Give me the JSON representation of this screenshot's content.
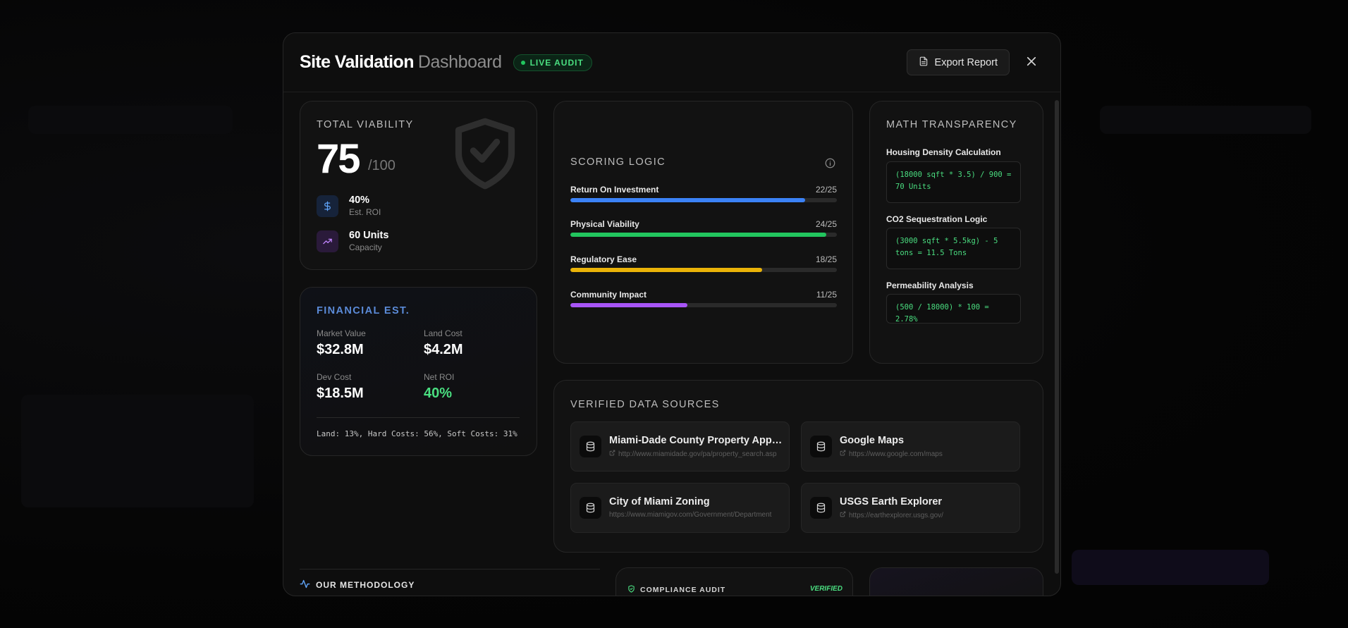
{
  "header": {
    "title": "Site Validation",
    "title_sub": "Dashboard",
    "badge": "LIVE AUDIT",
    "export_label": "Export Report"
  },
  "viability": {
    "label": "TOTAL VIABILITY",
    "score": "75",
    "score_max": "/100",
    "stats": [
      {
        "value": "40%",
        "label": "Est. ROI",
        "icon": "dollar-icon",
        "color": "#60a5fa"
      },
      {
        "value": "60 Units",
        "label": "Capacity",
        "icon": "trend-up-icon",
        "color": "#c084fc"
      }
    ]
  },
  "financial": {
    "label": "FINANCIAL EST.",
    "items": [
      {
        "label": "Market Value",
        "value": "$32.8M"
      },
      {
        "label": "Land Cost",
        "value": "$4.2M"
      },
      {
        "label": "Dev Cost",
        "value": "$18.5M"
      },
      {
        "label": "Net ROI",
        "value": "40%"
      }
    ],
    "footer": "Land: 13%, Hard Costs: 56%, Soft Costs: 31%"
  },
  "scoring": {
    "label": "SCORING LOGIC",
    "bars": [
      {
        "name": "Return On Investment",
        "score": "22/25",
        "fraction": 0.88,
        "color": "#3b82f6"
      },
      {
        "name": "Physical Viability",
        "score": "24/25",
        "fraction": 0.96,
        "color": "#22c55e"
      },
      {
        "name": "Regulatory Ease",
        "score": "18/25",
        "fraction": 0.72,
        "color": "#eab308"
      },
      {
        "name": "Community Impact",
        "score": "11/25",
        "fraction": 0.44,
        "color": "#a855f7"
      }
    ]
  },
  "math": {
    "label": "MATH TRANSPARENCY",
    "items": [
      {
        "title": "Housing Density Calculation",
        "formula": "(18000 sqft * 3.5) / 900 = 70 Units"
      },
      {
        "title": "CO2 Sequestration Logic",
        "formula": "(3000 sqft * 5.5kg) - 5 tons = 11.5 Tons"
      },
      {
        "title": "Permeability Analysis",
        "formula": "(500 / 18000) * 100 = 2.78%"
      }
    ]
  },
  "sources": {
    "label": "VERIFIED DATA SOURCES",
    "items": [
      {
        "name": "Miami-Dade County Property Appra...",
        "url": "http://www.miamidade.gov/pa/property_search.asp"
      },
      {
        "name": "Google Maps",
        "url": "https://www.google.com/maps"
      },
      {
        "name": "City of Miami Zoning",
        "url": "https://www.miamigov.com/Government/Department"
      },
      {
        "name": "USGS Earth Explorer",
        "url": "https://earthexplorer.usgs.gov/"
      }
    ]
  },
  "methodology": {
    "label": "OUR METHODOLOGY"
  },
  "compliance": {
    "label": "COMPLIANCE AUDIT",
    "status": "VERIFIED"
  },
  "colors": {
    "accent_green": "#4ade80",
    "accent_blue": "#5b8bd8"
  }
}
